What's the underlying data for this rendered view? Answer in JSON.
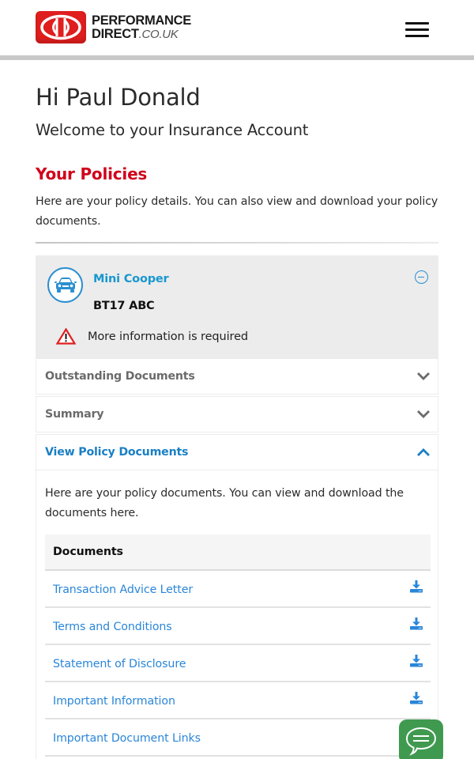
{
  "header": {
    "logo": {
      "line1": "PERFORMANCE",
      "line2": "DIRECT",
      "tld": ".CO.UK"
    },
    "menu_icon": "hamburger-icon"
  },
  "greeting": {
    "title": "Hi Paul Donald",
    "subtitle": "Welcome to your Insurance Account"
  },
  "policies": {
    "title": "Your Policies",
    "description": "Here are your policy details. You can also view and download your policy documents."
  },
  "policy": {
    "icon": "car-icon",
    "vehicle": "Mini Cooper",
    "registration": "BT17 ABC",
    "collapse_icon": "minus-circle-icon",
    "warning_icon": "warning-triangle-icon",
    "warning_text": "More information is required"
  },
  "accordion": [
    {
      "label": "Outstanding Documents",
      "expanded": false,
      "icon": "chevron-down-icon"
    },
    {
      "label": "Summary",
      "expanded": false,
      "icon": "chevron-down-icon"
    },
    {
      "label": "View Policy Documents",
      "expanded": true,
      "icon": "chevron-up-icon"
    }
  ],
  "documents_panel": {
    "description": "Here are your policy documents. You can view and download the documents here.",
    "table_header": "Documents",
    "documents": [
      {
        "name": "Transaction Advice Letter",
        "icon": "download-icon"
      },
      {
        "name": "Terms and Conditions",
        "icon": "download-icon"
      },
      {
        "name": "Statement of Disclosure",
        "icon": "download-icon"
      },
      {
        "name": "Important Information",
        "icon": "download-icon"
      },
      {
        "name": "Important Document Links",
        "icon": "download-icon"
      }
    ]
  },
  "chat": {
    "icon": "chat-bubble-icon"
  },
  "colors": {
    "brand_red": "#d0021b",
    "logo_red": "#e01e1e",
    "link_blue": "#2a86d9",
    "accent_blue": "#1a97cf",
    "chat_green": "#3f9a4f",
    "card_grey": "#ececec"
  }
}
